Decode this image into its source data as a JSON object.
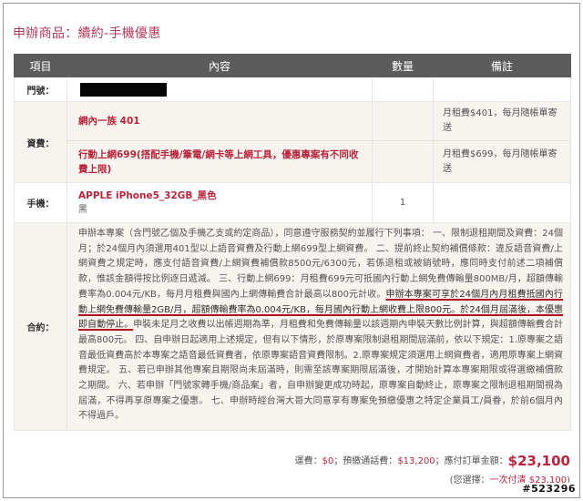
{
  "page_title": "申辦商品：續約-手機優惠",
  "table_headers": {
    "item": "項目",
    "content": "內容",
    "qty": "數量",
    "note": "備註"
  },
  "door_row": {
    "label": "門號："
  },
  "fee_row": {
    "label": "資費：",
    "plans": [
      {
        "name": "網內一族 401",
        "note": "月租費$401，每月隨帳單寄送"
      },
      {
        "name": "行動上網699(搭配手機/筆電/網卡等上網工具，優惠專案有不同收費上限)",
        "note": "月租費$699，每月隨帳單寄送"
      }
    ]
  },
  "phone_row": {
    "label": "手機：",
    "name": "APPLE iPhone5_32GB_黑色",
    "color": "黑",
    "qty": "1"
  },
  "contract_row": {
    "label": "合約：",
    "terms_p1": "申辦本專案（含門號乙個及手機乙支或約定商品），同意遵守服務契約並履行下列事項： 一、限制退租期間及資費：24個月；於24個月內須選用401型以上語音資費及行動上網699型上網資費。 二、提前終止契約補償條款：違反語音資費/上網資費之規定時，應支付語音資費/上網資費補償款8500元/6300元，若係退租或被銷號時，應同時支付前述二項補償款，惟該金額得按比例逐日遞減。 三、行動上網699：月租費699元可抵國內行動上網免費傳輸量800MB/月，超額傳輸費率為0.004元/KB，每月月租費與國內上網傳輸費合計最高以800元計收。",
    "terms_highlight_1": "申辦本專案可享於24個月內月租費抵國內行動上網免費傳輸量2GB/月，超額傳輸費率為0.004元/KB，每月國內行動上網收費上限800元。",
    "terms_highlight_2": "於24個月屆滿後，本優惠即自動停止。",
    "terms_p2": "申裝未足月之收費以出帳週期為準，月租費和免費傳輸量以該週期內申裝天數比例計算，與超額傳輸費合計最高800元。 四、自申辦日起適用上述規定，但有以下情形，於原專案限制退租期間屆滿前，依以下規定：1.原專案之語音最低資費高於本專案之語音最低資費者，依原專案語音資費限制。2.原專案規定須選用上網資費者，適用原專案上網資費規定。 五、若已申辦其他專案且期限尚未屆滿時，則需至該專案期限屆滿後，才開始計算本專案期限或得選繳補償款之期間。 六、若申辦「門號家轉手機/商品案」者，自申辦變更成功時起，原專案自動終止，原專案之限制退租期間視為屆滿，不得再享原專案之優惠。 七、申辦時經台灣大哥大同意享有專案免預繳優惠之特定企業員工/員眷，於前6個月內不得過戶。"
  },
  "summary": {
    "shipping_label": "運費：",
    "shipping_value": "$0",
    "prepay_label": "；預繳通話費：",
    "prepay_value": "$13,200",
    "total_label": "；應付訂單金額：",
    "total_value": "$23,100",
    "choice_label": "(您選擇：",
    "choice_value": "一次付清 $23,100",
    "choice_close": ")"
  },
  "watermark": "#523296"
}
